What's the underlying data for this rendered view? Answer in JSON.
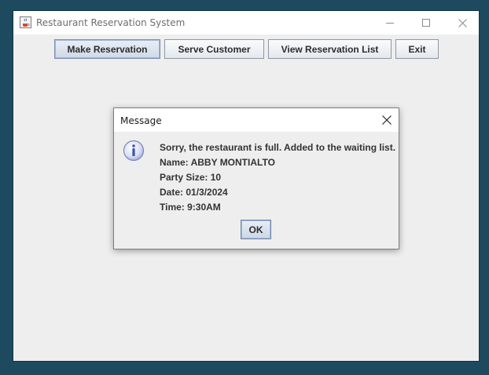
{
  "window": {
    "title": "Restaurant Reservation System",
    "icon": "java-cup-icon"
  },
  "toolbar": {
    "make_reservation": "Make Reservation",
    "serve_customer": "Serve Customer",
    "view_reservation_list": "View Reservation List",
    "exit": "Exit"
  },
  "dialog": {
    "title": "Message",
    "icon": "info-icon",
    "lines": [
      "Sorry, the restaurant is full. Added to the waiting list.",
      "Name: ABBY MONTIALTO",
      "Party Size: 10",
      "Date: 01/3/2024",
      "Time: 9:30AM"
    ],
    "ok_label": "OK"
  },
  "colors": {
    "desktop": "#1d4a5e",
    "window_bg": "#eeeeee",
    "titlebar_bg": "#ffffff",
    "button_focus": "#cfd9e6",
    "info_icon": "#3d53a8"
  }
}
